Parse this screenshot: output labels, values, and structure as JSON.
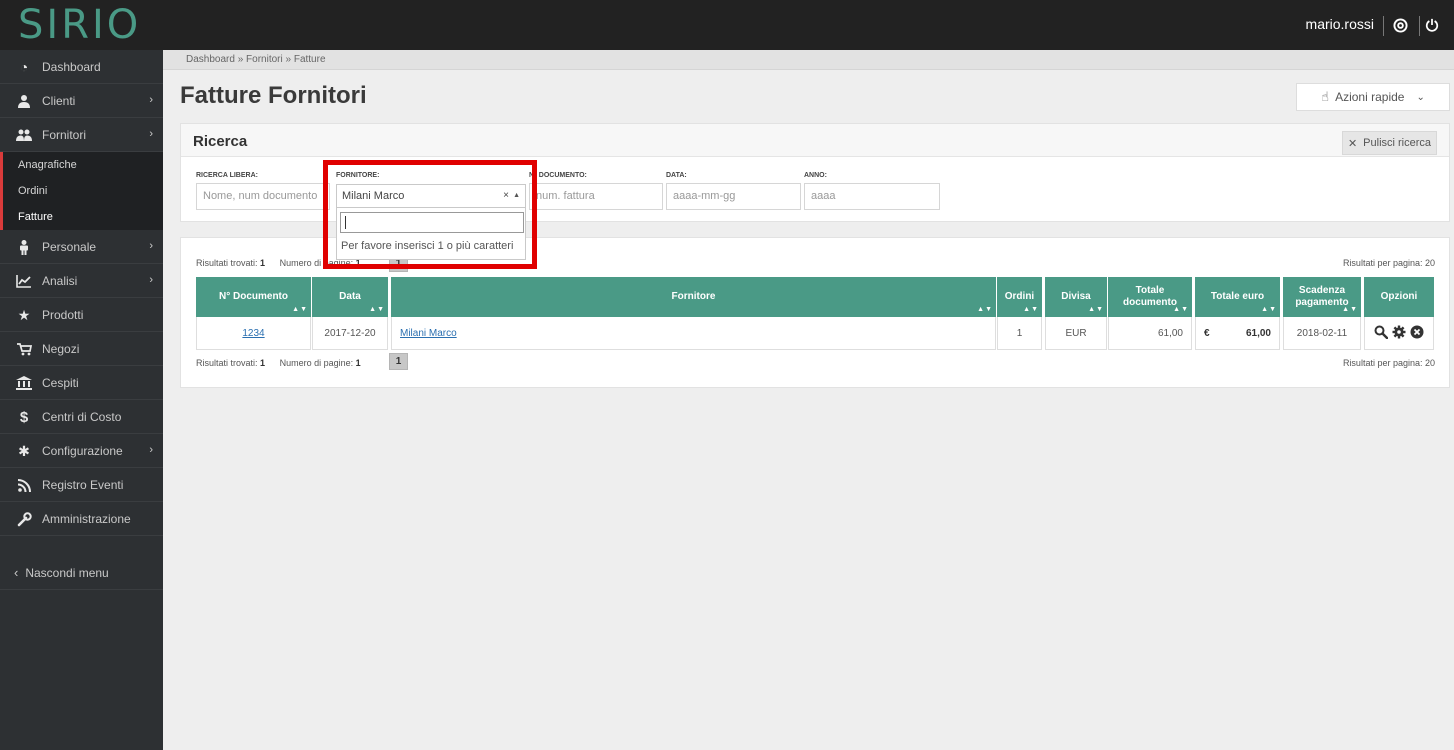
{
  "app": {
    "logo": "SIRIO",
    "user": "mario.rossi"
  },
  "sidebar": {
    "items": [
      {
        "label": "Dashboard",
        "icon": "dashboard-icon"
      },
      {
        "label": "Clienti",
        "icon": "user-icon"
      },
      {
        "label": "Fornitori",
        "icon": "users-icon"
      },
      {
        "label": "Personale",
        "icon": "person-icon"
      },
      {
        "label": "Analisi",
        "icon": "chart-line-icon"
      },
      {
        "label": "Prodotti",
        "icon": "star-icon"
      },
      {
        "label": "Negozi",
        "icon": "cart-icon"
      },
      {
        "label": "Cespiti",
        "icon": "bank-icon"
      },
      {
        "label": "Centri di Costo",
        "icon": "dollar-icon"
      },
      {
        "label": "Configurazione",
        "icon": "gear-icon"
      },
      {
        "label": "Registro Eventi",
        "icon": "rss-icon"
      },
      {
        "label": "Amministrazione",
        "icon": "wrench-icon"
      }
    ],
    "fornitori_sub": [
      "Anagrafiche",
      "Ordini",
      "Fatture"
    ],
    "hide_menu": "Nascondi menu"
  },
  "breadcrumb": "Dashboard » Fornitori » Fatture",
  "page_title": "Fatture Fornitori",
  "quick_actions": "Azioni rapide",
  "search": {
    "title": "Ricerca",
    "clear_label": "Pulisci ricerca",
    "free_label": "RICERCA LIBERA:",
    "free_placeholder": "Nome, num documento",
    "supplier_label": "FORNITORE:",
    "supplier_value": "Milani Marco",
    "supplier_hint": "Per favore inserisci 1 o più caratteri",
    "doc_label": "N° DOCUMENTO:",
    "doc_placeholder": "num. fattura",
    "date_label": "DATA:",
    "date_placeholder": "aaaa-mm-gg",
    "year_label": "ANNO:",
    "year_placeholder": "aaaa"
  },
  "results": {
    "found_label": "Risultati trovati:",
    "found": "1",
    "pages_label": "Numero di pagine:",
    "pages": "1",
    "page_current": "1",
    "per_page": "Risultati per pagina: 20",
    "columns": {
      "doc": "N° Documento",
      "date": "Data",
      "supplier": "Fornitore",
      "orders": "Ordini",
      "currency": "Divisa",
      "total_doc": "Totale documento",
      "total_eur": "Totale euro",
      "due": "Scadenza pagamento",
      "options": "Opzioni"
    },
    "row": {
      "doc": "1234",
      "date": "2017-12-20",
      "supplier": "Milani Marco",
      "orders": "1",
      "currency": "EUR",
      "total_doc": "61,00",
      "eur_symbol": "€",
      "total_eur": "61,00",
      "due": "2018-02-11"
    }
  },
  "colors": {
    "accent": "#4a9a86",
    "topbar": "#222222",
    "sidebar": "#2d3033",
    "highlight": "#e00000"
  }
}
